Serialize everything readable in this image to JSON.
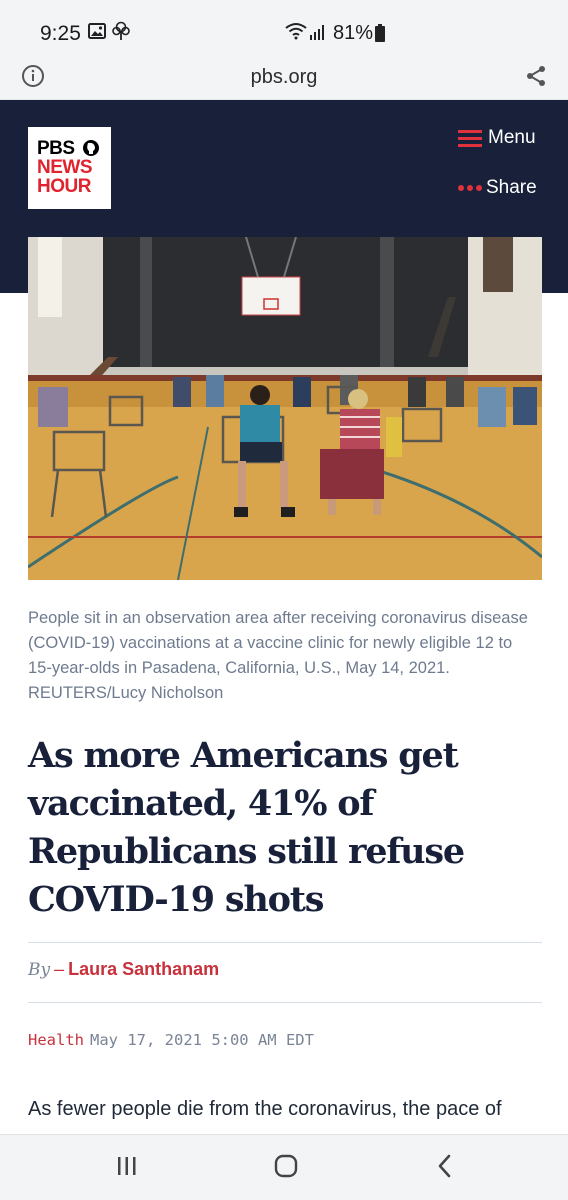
{
  "status_bar": {
    "time": "9:25",
    "battery": "81%"
  },
  "url_bar": {
    "domain": "pbs.org"
  },
  "header": {
    "logo_line1": "PBS",
    "logo_line2": "NEWS",
    "logo_line3": "HOUR",
    "menu_label": "Menu",
    "share_label": "Share"
  },
  "article": {
    "caption": "People sit in an observation area after receiving coronavirus disease (COVID-19) vaccinations at a vaccine clinic for newly eligible 12 to 15-year-olds in Pasadena, California, U.S., May 14, 2021. REUTERS/Lucy Nicholson",
    "headline": "As more Americans get vaccinated, 41% of Republicans still refuse COVID-19 shots",
    "by_label": "By",
    "by_dash": "–",
    "author": "Laura Santhanam",
    "category": "Health",
    "date": "May 17, 2021 5:00 AM EDT",
    "lead": "As fewer people die from the coronavirus, the pace of"
  },
  "colors": {
    "header_bg": "#18203a",
    "accent_red": "#c8323d",
    "logo_red": "#e0232e"
  },
  "icons": {
    "status": [
      "gallery-icon",
      "tree-icon",
      "wifi-icon",
      "signal-icon",
      "battery-icon"
    ],
    "url_bar": [
      "info-icon",
      "share-icon"
    ],
    "header": [
      "hamburger-icon",
      "dots-icon"
    ],
    "nav": [
      "recent-apps-icon",
      "home-icon",
      "back-icon"
    ]
  }
}
